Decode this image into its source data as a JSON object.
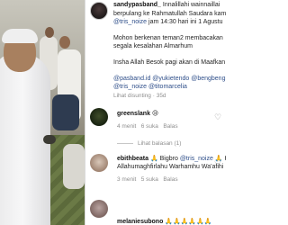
{
  "post": {
    "username": "sandypasband_",
    "text_line1": "Innalillahi wainnaillai",
    "text_line2": "berpulang ke Rahmatullah Saudara kam",
    "mention_1": "@tris_noize",
    "text_line3_rest": " jam 14:30 hari ini 1 Agustu",
    "text_line4": "Mohon berkenan teman2 membacakan",
    "text_line5": "segala kesalahan Almarhum",
    "text_line6": "Insha Allah Besok pagi akan di Maafkan",
    "mentions_line": "@pasband.id @yukietendo @bengbeng",
    "mentions_line2": "@tris_noize @titomarcelia",
    "see_translation": "Lihat disunting",
    "time": " · 35d"
  },
  "comments": [
    {
      "username": "greenslank",
      "text": "😢",
      "time": "4 menit",
      "likes": "6 suka",
      "reply": "Balas",
      "view_replies": "Lihat balasan (1)"
    },
    {
      "username": "ebithbeata",
      "text_part1": " 🙏 Bigbro ",
      "mention": "@tris_noize",
      "text_part2": " 🙏 H",
      "text_line2": "Allahumaghfirlahu Warhamhu Wa'afihi",
      "time": "3 menit",
      "likes": "5 suka",
      "reply": "Balas"
    },
    {
      "username": "melaniesubono",
      "text": " 🙏🙏🙏🙏🙏🙏"
    }
  ],
  "icons": {
    "like": "heart-icon"
  }
}
